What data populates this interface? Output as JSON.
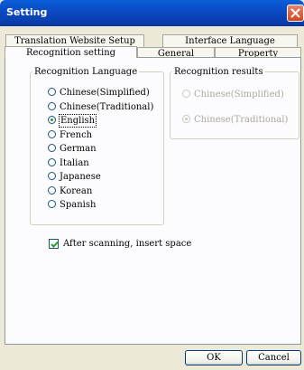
{
  "window": {
    "title": "Setting"
  },
  "tabs": {
    "row_back": [
      "Translation Website Setup",
      "Interface Language"
    ],
    "row_front": [
      "Recognition setting",
      "General",
      "Property"
    ]
  },
  "recognition_language": {
    "legend": "Recognition Language",
    "options": [
      "Chinese(Simplified)",
      "Chinese(Traditional)",
      "English",
      "French",
      "German",
      "Italian",
      "Japanese",
      "Korean",
      "Spanish"
    ],
    "selected": "English"
  },
  "recognition_results": {
    "legend": "Recognition results",
    "options": [
      "Chinese(Simplified)",
      "Chinese(Traditional)"
    ],
    "selected": "Chinese(Traditional)"
  },
  "option_insert_space": {
    "label": "After scanning, insert space",
    "checked": true
  },
  "buttons": {
    "ok": "OK",
    "cancel": "Cancel"
  },
  "colors": {
    "titlebar": "#0b49c2",
    "close": "#d2461d",
    "dialog": "#ece9d8",
    "panel": "#fcfcfe",
    "radio_dot": "#21a121"
  }
}
